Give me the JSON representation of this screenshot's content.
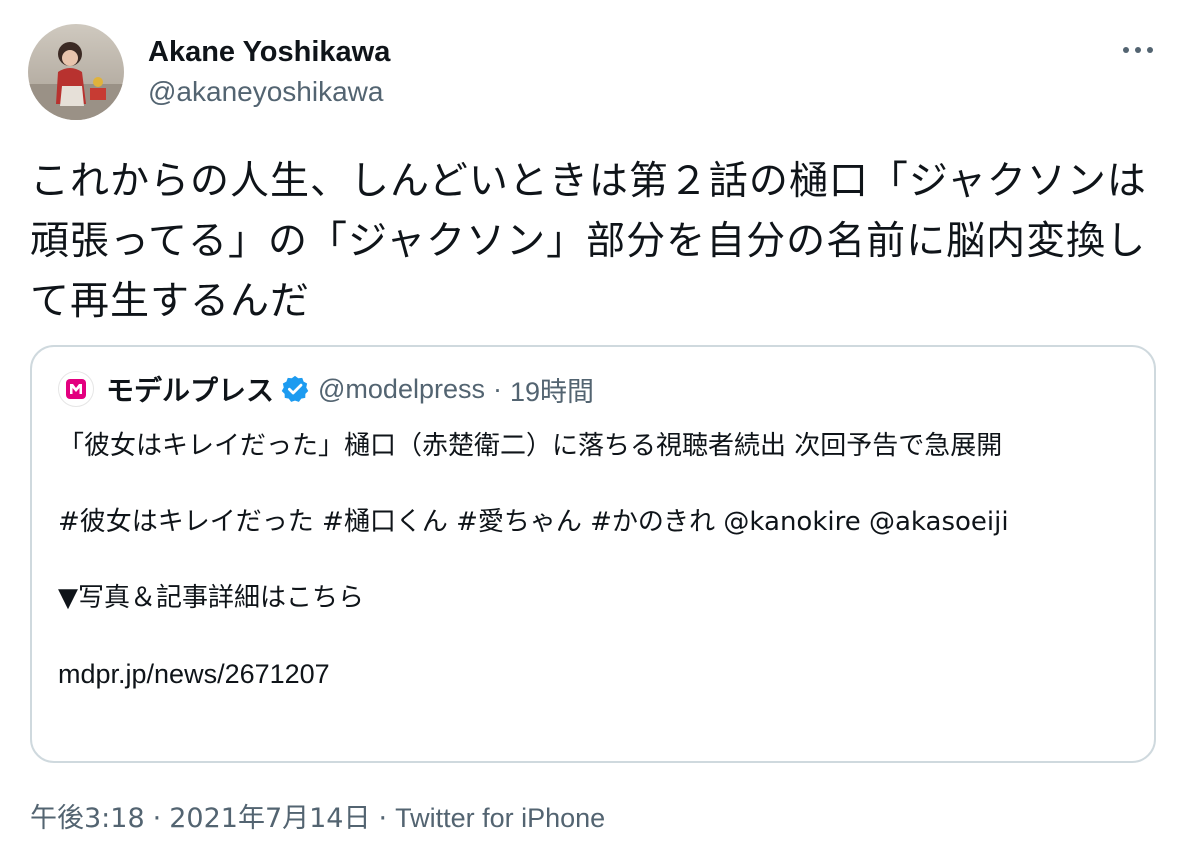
{
  "author": {
    "display_name": "Akane Yoshikawa",
    "handle": "@akaneyoshikawa"
  },
  "tweet": {
    "text": "これからの人生、しんどいときは第２話の樋口「ジャクソンは頑張ってる」の「ジャクソン」部分を自分の名前に脳内変換して再生するんだ"
  },
  "quoted_tweet": {
    "account_name": "モデルプレス",
    "handle": "@modelpress",
    "separator": "·",
    "time": "19時間",
    "body_line1": "「彼女はキレイだった」樋口（赤楚衛二）に落ちる視聴者続出 次回予告で急展開",
    "hashtags": "#彼女はキレイだった #樋口くん #愛ちゃん #かのきれ @kanokire @akasoeiji",
    "photo_line": "▼写真＆記事詳細はこちら",
    "link": "mdpr.jp/news/2671207"
  },
  "meta": {
    "time": "午後3:18",
    "separator": "·",
    "date": "2021年7月14日",
    "source": "Twitter for iPhone"
  },
  "icons": {
    "more": "more-horizontal-icon",
    "verified": "verified-badge-icon",
    "logo": "modelpress-logo-icon"
  },
  "colors": {
    "text_primary": "#0f1419",
    "text_secondary": "#536471",
    "border": "#cfd9de",
    "verified_blue": "#1d9bf0",
    "brand_pink": "#e3007f"
  }
}
